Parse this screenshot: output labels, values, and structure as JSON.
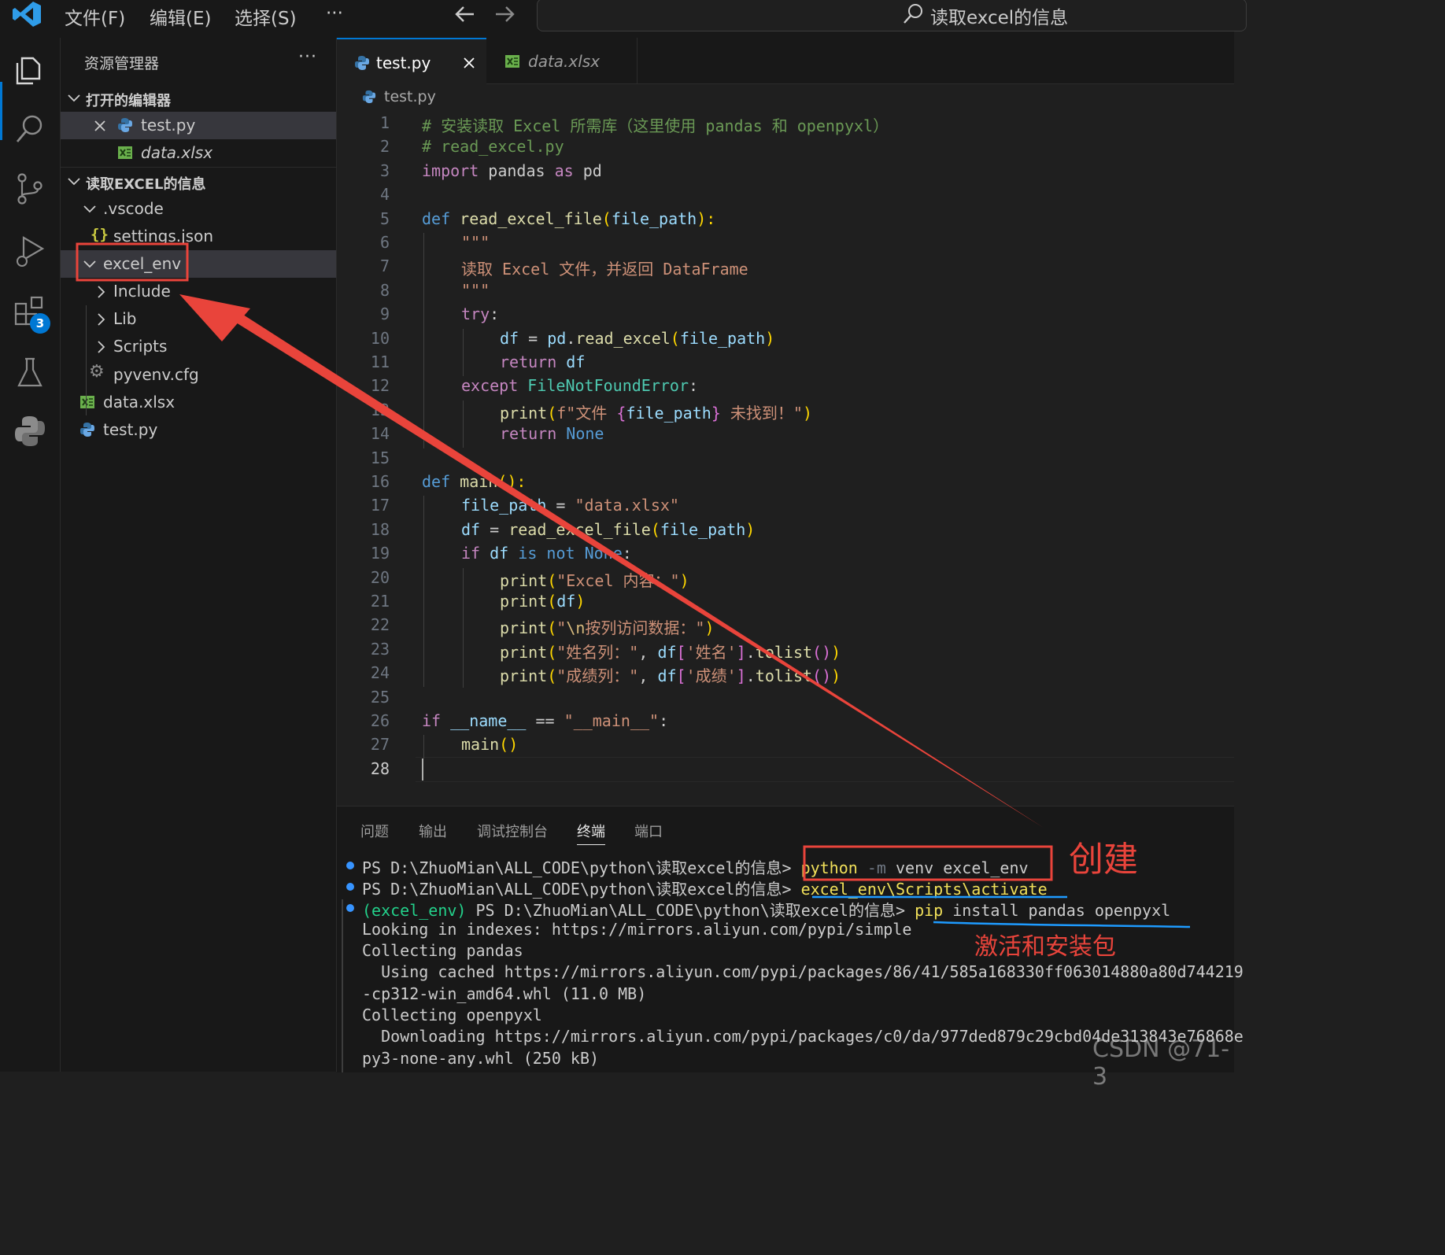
{
  "titlebar": {
    "menus": [
      "文件(F)",
      "编辑(E)",
      "选择(S)",
      "···"
    ],
    "search_text": "读取excel的信息"
  },
  "activity": {
    "extensions_badge": "3"
  },
  "sidebar": {
    "title": "资源管理器",
    "more": "···",
    "open_editors": {
      "header": "打开的编辑器",
      "items": [
        "test.py",
        "data.xlsx"
      ]
    },
    "folder": {
      "header": "读取EXCEL的信息",
      "items": [
        ".vscode",
        "settings.json",
        "excel_env",
        "Include",
        "Lib",
        "Scripts",
        "pyvenv.cfg",
        "data.xlsx",
        "test.py"
      ]
    }
  },
  "editor": {
    "tabs": [
      "test.py",
      "data.xlsx"
    ],
    "breadcrumb": "test.py",
    "line_numbers": [
      "1",
      "2",
      "3",
      "4",
      "5",
      "6",
      "7",
      "8",
      "9",
      "10",
      "11",
      "12",
      "13",
      "14",
      "15",
      "16",
      "17",
      "18",
      "19",
      "20",
      "21",
      "22",
      "23",
      "24",
      "25",
      "26",
      "27",
      "28"
    ],
    "code": {
      "l1": "# 安装读取 Excel 所需库（这里使用 pandas 和 openpyxl）",
      "l2": "# read_excel.py",
      "l3": [
        "import",
        " pandas ",
        "as",
        " pd"
      ],
      "l5": [
        "def",
        " ",
        "read_excel_file",
        "(",
        "file_path",
        "):"
      ],
      "l6": "\"\"\"",
      "l7": "读取 Excel 文件，并返回 DataFrame",
      "l8": "\"\"\"",
      "l9": [
        "try",
        ":"
      ],
      "l10": [
        "df",
        " = ",
        "pd",
        ".",
        "read_excel",
        "(",
        "file_path",
        ")"
      ],
      "l11": [
        "return",
        " ",
        "df"
      ],
      "l12": [
        "except",
        " ",
        "FileNotFoundError",
        ":"
      ],
      "l13": [
        "print",
        "(",
        "f\"文件 ",
        "{",
        "file_path",
        "}",
        " 未找到！\"",
        ")"
      ],
      "l14": [
        "return",
        " ",
        "None"
      ],
      "l16": [
        "def",
        " ",
        "main",
        "():"
      ],
      "l17": [
        "file_path",
        " = ",
        "\"data.xlsx\""
      ],
      "l18": [
        "df",
        " = ",
        "read_excel_file",
        "(",
        "file_path",
        ")"
      ],
      "l19": [
        "if",
        " ",
        "df",
        " ",
        "is not",
        " ",
        "None",
        ":"
      ],
      "l20": [
        "print",
        "(",
        "\"Excel 内容：\"",
        ")"
      ],
      "l21": [
        "print",
        "(",
        "df",
        ")"
      ],
      "l22": [
        "print",
        "(",
        "\"",
        "\\n",
        "按列访问数据：\"",
        ")"
      ],
      "l23": [
        "print",
        "(",
        "\"姓名列：\"",
        ", ",
        "df",
        "[",
        "'姓名'",
        "]",
        ".",
        "tolist",
        "()",
        ")"
      ],
      "l24": [
        "print",
        "(",
        "\"成绩列：\"",
        ", ",
        "df",
        "[",
        "'成绩'",
        "]",
        ".",
        "tolist",
        "()",
        ")"
      ],
      "l26": [
        "if",
        " ",
        "__name__",
        " == ",
        "\"__main__\"",
        ":"
      ],
      "l27": [
        "main",
        "()"
      ]
    }
  },
  "panel": {
    "tabs": [
      "问题",
      "输出",
      "调试控制台",
      "终端",
      "端口"
    ],
    "terminal": {
      "prompt1": "PS D:\\ZhuoMian\\ALL_CODE\\python\\读取excel的信息> ",
      "cmd1_a": "python",
      "cmd1_b": " -m ",
      "cmd1_c": "venv excel_env",
      "prompt2": "PS D:\\ZhuoMian\\ALL_CODE\\python\\读取excel的信息> ",
      "cmd2": "excel_env\\Scripts\\activate",
      "env3": "(excel_env)",
      "prompt3": " PS D:\\ZhuoMian\\ALL_CODE\\python\\读取excel的信息> ",
      "cmd3_a": "pip",
      "cmd3_b": " install pandas openpyxl",
      "out1": "Looking in indexes: https://mirrors.aliyun.com/pypi/simple",
      "out2": "Collecting pandas",
      "out3": "  Using cached https://mirrors.aliyun.com/pypi/packages/86/41/585a168330ff063014880a80d744219",
      "out4": "-cp312-win_amd64.whl (11.0 MB)",
      "out5": "Collecting openpyxl",
      "out6": "  Downloading https://mirrors.aliyun.com/pypi/packages/c0/da/977ded879c29cbd04de313843e76868e",
      "out7": "py3-none-any.whl (250 kB)"
    }
  },
  "annotations": {
    "create": "创建",
    "activate_install": "激活和安装包",
    "watermark": "CSDN @71-3"
  },
  "colors": {
    "accent": "#0078d4",
    "annotation": "#e9443b",
    "underline": "#1e9bff"
  }
}
